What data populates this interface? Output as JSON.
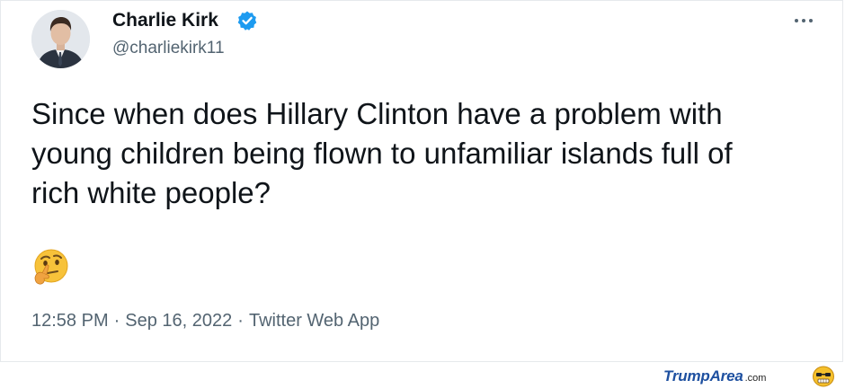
{
  "tweet": {
    "author_name": "Charlie Kirk",
    "author_handle": "@charliekirk11",
    "text_lines": [
      "Since when does Hillary Clinton have a problem with",
      "young children being flown to unfamiliar islands full of",
      "rich white people?"
    ],
    "emoji": "thinking-face",
    "time": "12:58 PM",
    "date": "Sep 16, 2022",
    "separator": "·",
    "source_app": "Twitter Web App"
  },
  "watermark": {
    "main": "TrumpArea",
    "suffix": ".com"
  },
  "colors": {
    "text_primary": "#0f1419",
    "text_secondary": "#536471",
    "verified_blue": "#1d9bf0",
    "watermark_blue": "#1e50a0"
  }
}
